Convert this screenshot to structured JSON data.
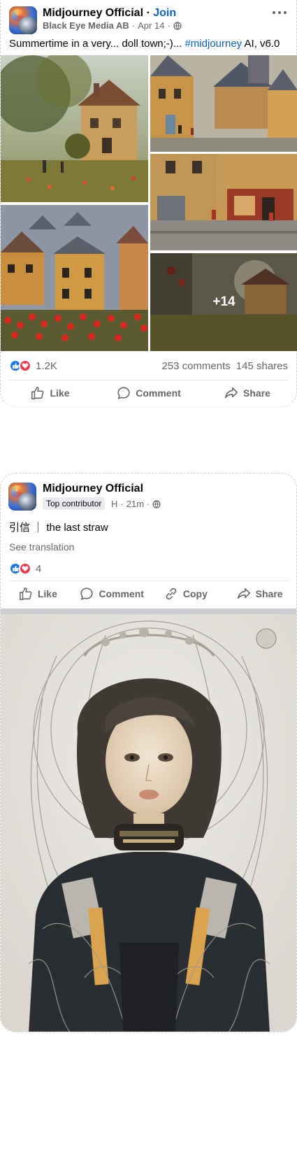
{
  "post1": {
    "page_name": "Midjourney Official",
    "separator": "·",
    "join_label": "Join",
    "sub_author": "Black Eye Media AB",
    "sub_date": "Apr 14",
    "more_icon": "more-horizontal-icon",
    "caption_text": "Summertime in a very... doll town;-)... ",
    "caption_hashtag": "#midjourney",
    "caption_tail": " AI, v6.0",
    "more_photos": "+14",
    "reaction_count": "1.2K",
    "comments": "253 comments",
    "shares": "145 shares",
    "actions": {
      "like": "Like",
      "comment": "Comment",
      "share": "Share"
    }
  },
  "post2": {
    "page_name": "Midjourney Official",
    "badge": "Top contributor",
    "meta_initial": "H",
    "meta_time": "21m",
    "caption": "引信 ｜ the last straw",
    "see_translation": "See translation",
    "reaction_count": "4",
    "actions": {
      "like": "Like",
      "comment": "Comment",
      "copy": "Copy",
      "share": "Share"
    }
  },
  "colors": {
    "link_blue": "#0a63c9",
    "like_blue": "#1877f2",
    "love_red": "#f0384f",
    "muted": "#65676b"
  }
}
